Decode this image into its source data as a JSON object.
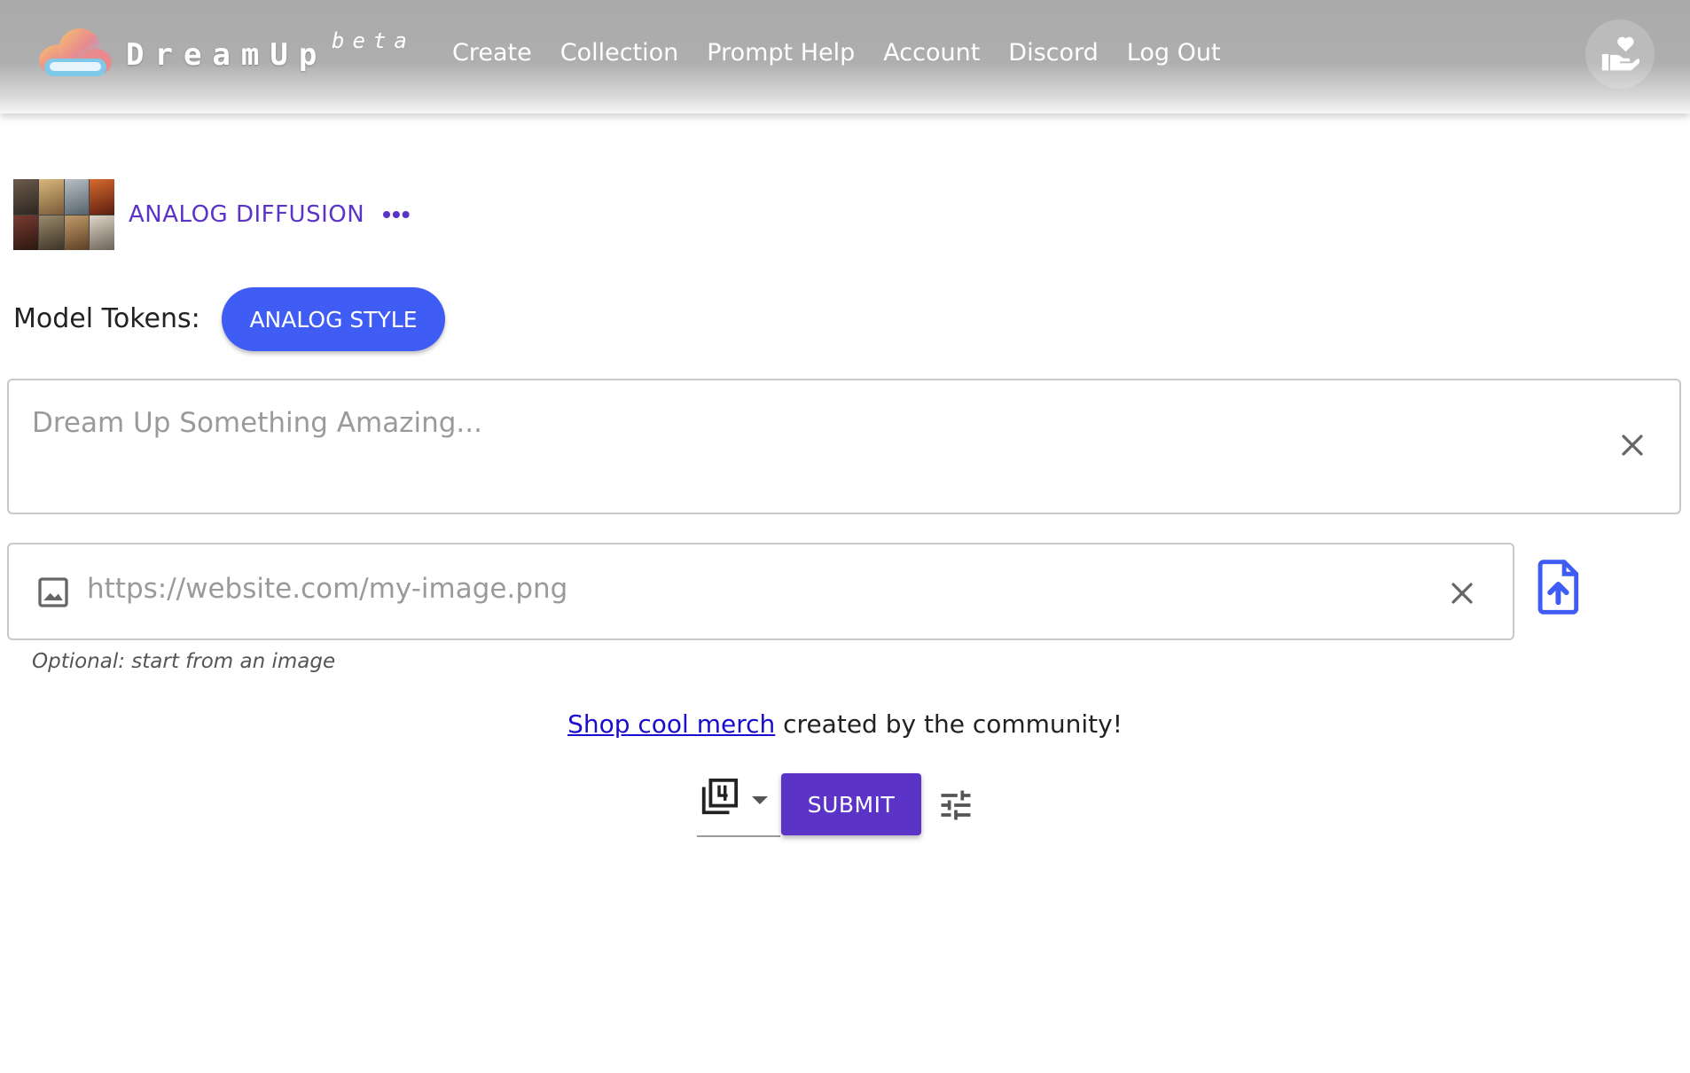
{
  "header": {
    "brand": "DreamUp",
    "brand_tag": "beta",
    "logo_icon": "cloud-logo-icon",
    "nav": [
      {
        "label": "Create"
      },
      {
        "label": "Collection"
      },
      {
        "label": "Prompt Help"
      },
      {
        "label": "Account"
      },
      {
        "label": "Discord"
      },
      {
        "label": "Log Out"
      }
    ],
    "donate_icon": "hand-heart-icon"
  },
  "model": {
    "name": "ANALOG DIFFUSION",
    "more_label": "•••",
    "thumbnail_icon": "model-preview-grid"
  },
  "tokens": {
    "label": "Model Tokens:",
    "items": [
      "ANALOG STYLE"
    ]
  },
  "prompt": {
    "placeholder": "Dream Up Something Amazing...",
    "value": "",
    "clear_icon": "close-icon"
  },
  "image_url": {
    "placeholder": "https://website.com/my-image.png",
    "value": "",
    "hint": "Optional: start from an image",
    "leading_icon": "image-icon",
    "clear_icon": "close-icon",
    "upload_icon": "file-upload-icon"
  },
  "merch": {
    "link_text": "Shop cool merch",
    "rest_text": " created by the community!"
  },
  "submit_row": {
    "count_icon": "filter-4-icon",
    "submit_label": "SUBMIT",
    "settings_icon": "tune-icon"
  },
  "colors": {
    "accent_purple": "#5b34c7",
    "token_blue": "#3f5df5",
    "link_blue": "#1a0dcc",
    "header_gray": "#aaaaaa"
  }
}
